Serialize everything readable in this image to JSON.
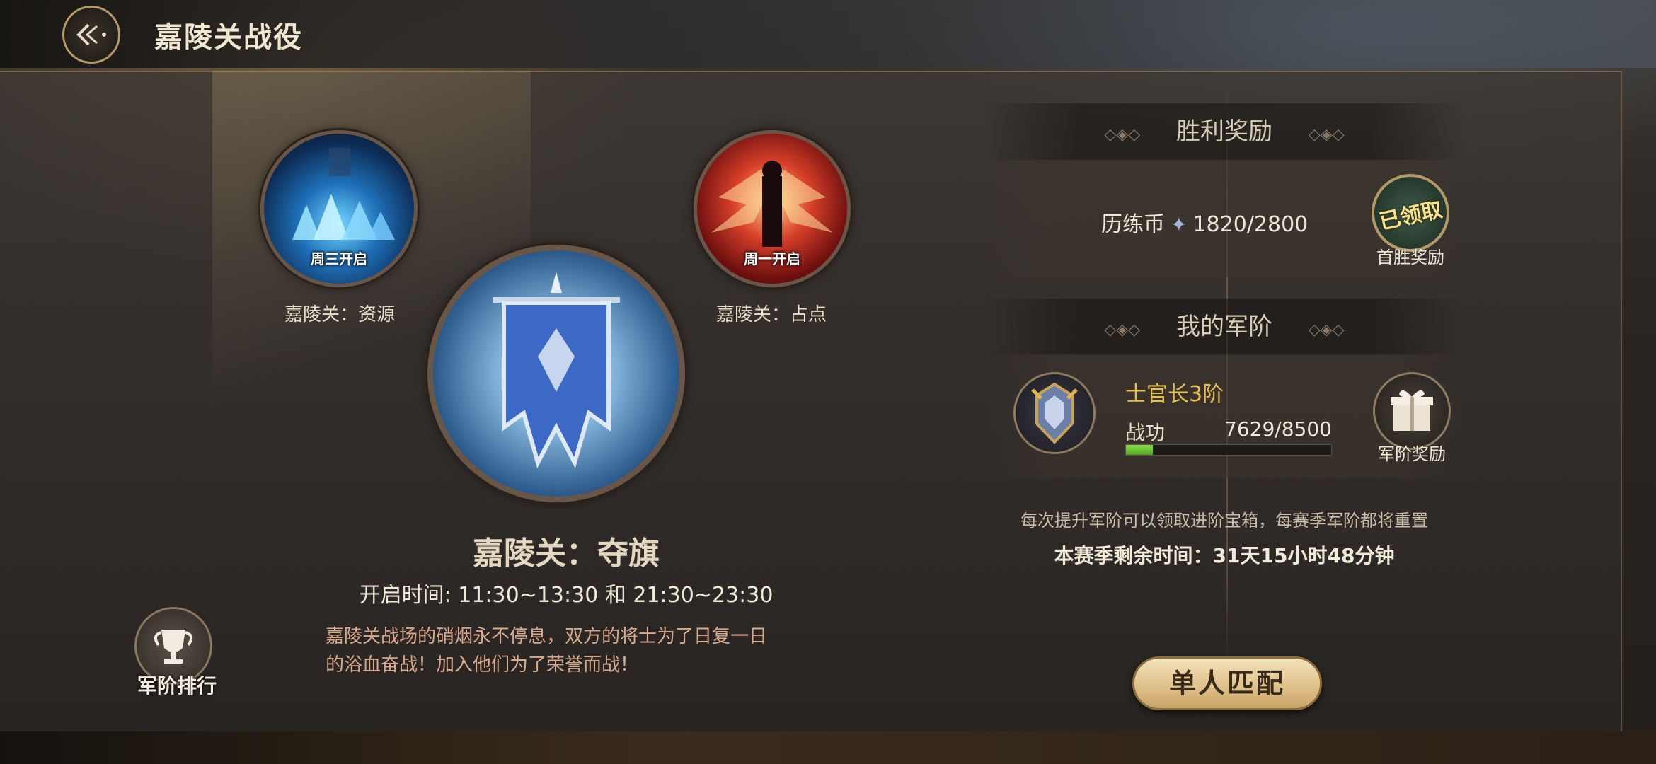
{
  "header": {
    "title": "嘉陵关战役"
  },
  "modes": {
    "resource": {
      "badge": "周三开启",
      "caption": "嘉陵关：资源"
    },
    "capture": {
      "badge": "周一开启",
      "caption": "嘉陵关：占点"
    }
  },
  "main": {
    "title": "嘉陵关：夺旗",
    "open_time": "开启时间: 11:30~13:30 和 21:30~23:30",
    "description": "嘉陵关战场的硝烟永不停息，双方的将士为了日复一日的浴血奋战！加入他们为了荣誉而战！"
  },
  "rank_ranking": {
    "label": "军阶排行"
  },
  "victory_reward": {
    "heading": "胜利奖励",
    "currency_label": "历练币",
    "currency_value": "1820/2800",
    "claimed_badge": "已领取",
    "first_win_label": "首胜奖励"
  },
  "my_rank": {
    "heading": "我的军阶",
    "rank_name": "士官长3阶",
    "merit_label": "战功",
    "merit_value": "7629/8500",
    "merit_progress": 0.13,
    "reward_label": "军阶奖励"
  },
  "notes": {
    "info": "每次提升军阶可以领取进阶宝箱，每赛季军阶都将重置",
    "season_remaining": "本赛季剩余时间：31天15小时48分钟"
  },
  "actions": {
    "single_match": "单人匹配"
  },
  "colors": {
    "accent_gold": "#e6c04a",
    "progress_green": "#6fcb34",
    "button_gold": "#e2c590"
  }
}
